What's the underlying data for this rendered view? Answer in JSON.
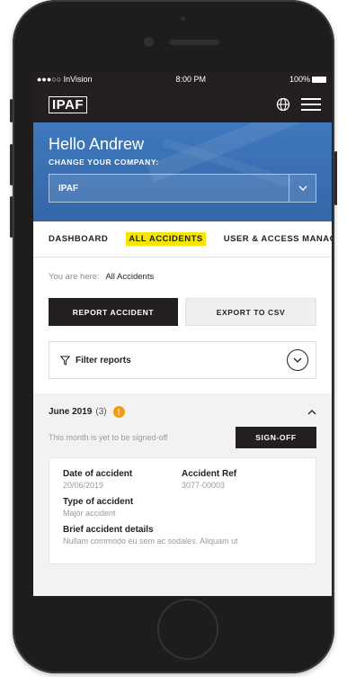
{
  "statusbar": {
    "carrier": "●●●○○ InVision",
    "time": "8:00 PM",
    "battery": "100%"
  },
  "appbar": {
    "logo": "IPAF",
    "icons": [
      "globe-icon",
      "hamburger-menu-icon"
    ]
  },
  "hero": {
    "greeting": "Hello Andrew",
    "change_company_label": "CHANGE YOUR COMPANY:",
    "company_value": "IPAF"
  },
  "tabs": [
    {
      "label": "DASHBOARD",
      "active": false
    },
    {
      "label": "ALL ACCIDENTS",
      "active": true
    },
    {
      "label": "USER & ACCESS MANAG",
      "active": false
    }
  ],
  "breadcrumb": {
    "prefix": "You are here:",
    "current": "All Accidents"
  },
  "actions": {
    "report": "REPORT ACCIDENT",
    "export": "EXPORT TO CSV"
  },
  "filter": {
    "label": "Filter reports"
  },
  "month": {
    "title": "June 2019",
    "count": "(3)",
    "badge": "!",
    "status_text": "This month is yet to be signed-off",
    "signoff_label": "SIGN-OFF"
  },
  "accident": {
    "date_label": "Date of accident",
    "date_value": "20/06/2019",
    "ref_label": "Accident Ref",
    "ref_value": "3077-00003",
    "type_label": "Type of accident",
    "type_value": "Major accident",
    "details_label": "Brief accident details",
    "details_value": "Nullam commodo eu sem ac sodales. Aliquam ut"
  },
  "colors": {
    "dark": "#231f20",
    "brand_blue": "#3f78bd",
    "highlight": "#f5e600",
    "warning": "#f39c12"
  }
}
